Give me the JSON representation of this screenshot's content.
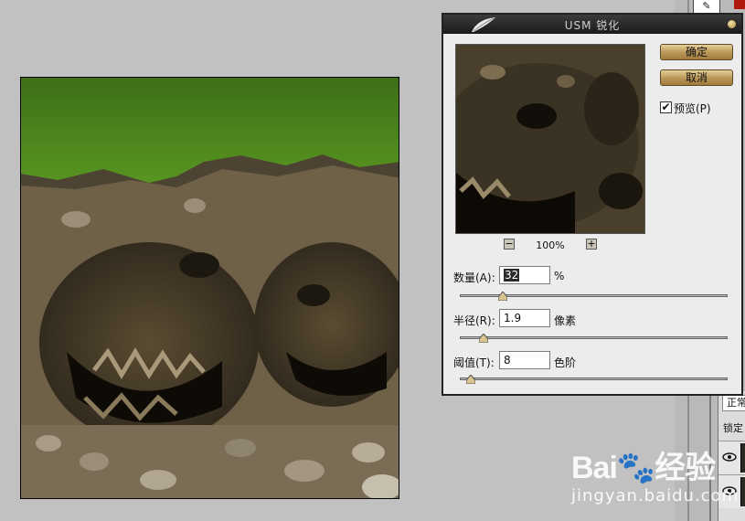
{
  "dialog": {
    "title": "USM 锐化",
    "ok_label": "确定",
    "cancel_label": "取消",
    "preview_label": "预览(P)",
    "preview_checked": "✔",
    "zoom_out": "−",
    "zoom_in": "+",
    "zoom_level": "100%",
    "amount": {
      "label": "数量(A):",
      "value": "32",
      "unit": "%",
      "slider_fraction": 0.16
    },
    "radius": {
      "label": "半径(R):",
      "value": "1.9",
      "unit": "像素",
      "slider_fraction": 0.09
    },
    "threshold": {
      "label": "阈值(T):",
      "value": "8",
      "unit": "色阶",
      "slider_fraction": 0.04
    }
  },
  "layers_panel": {
    "blend_mode": "正常",
    "lock_label": "锁定"
  },
  "toolbar": {
    "tool_glyph": "✎"
  },
  "watermark": {
    "brand": "Bai🐾经验",
    "site": "jingyan.baidu.com"
  },
  "colors": {
    "grass": "#4f8a1e",
    "soil": "#6b5d44",
    "dialog_bg": "#ececec",
    "button_gold": "#b89556",
    "titlebar": "#1a1a1a"
  }
}
